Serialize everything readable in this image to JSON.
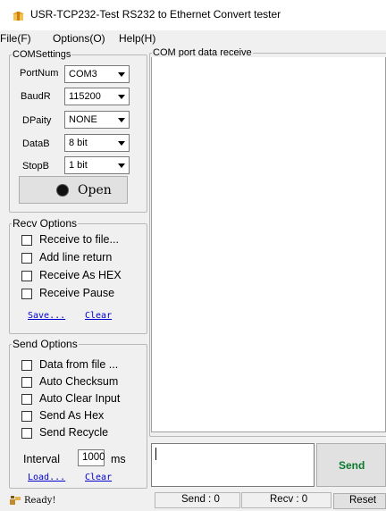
{
  "window": {
    "title": "USR-TCP232-Test  RS232 to Ethernet Convert tester",
    "icon": "app-icon"
  },
  "menu": [
    "File(F)",
    "Options(O)",
    "Help(H)"
  ],
  "com_settings": {
    "legend": "COMSettings",
    "port_label": "PortNum",
    "port_value": "COM3",
    "baud_label": "BaudR",
    "baud_value": "115200",
    "parity_label": "DPaity",
    "parity_value": "NONE",
    "databits_label": "DataB",
    "databits_value": "8 bit",
    "stopbits_label": "StopB",
    "stopbits_value": "1 bit",
    "open_label": "Open"
  },
  "recv_options": {
    "legend": "Recv Options",
    "items": [
      "Receive to file...",
      "Add line return",
      "Receive As HEX",
      "Receive Pause"
    ],
    "save_link": "Save...",
    "clear_link": "Clear"
  },
  "send_options": {
    "legend": "Send Options",
    "items": [
      "Data from file ...",
      "Auto Checksum",
      "Auto Clear Input",
      "Send As Hex",
      "Send Recycle"
    ],
    "interval_label": "Interval",
    "interval_value": "1000",
    "interval_unit": "ms",
    "load_link": "Load...",
    "clear_link": "Clear"
  },
  "receive_panel": {
    "legend": "COM port data receive"
  },
  "send_button": {
    "label": "Send",
    "color": "#0b7a2e"
  },
  "status": {
    "text": "Ready!",
    "send_count": "Send : 0",
    "recv_count": "Recv : 0",
    "reset_label": "Reset"
  }
}
